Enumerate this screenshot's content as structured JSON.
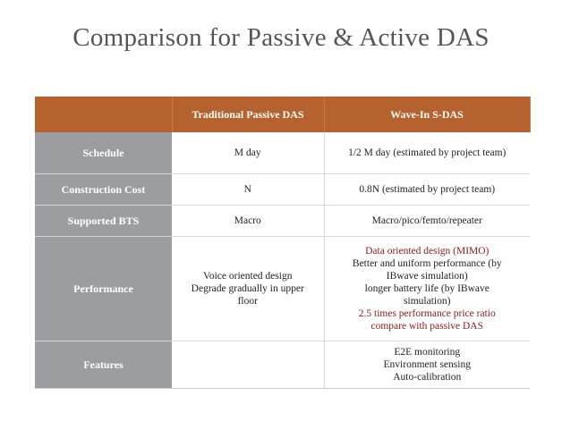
{
  "title": "Comparison for Passive & Active DAS",
  "table": {
    "header": {
      "corner": "",
      "col1": "Traditional Passive DAS",
      "col2": "Wave-In S-DAS"
    },
    "rows": [
      {
        "label": "Schedule",
        "passive": [
          "M day"
        ],
        "active": [
          {
            "text": "1/2 M day (estimated by project team)",
            "highlight": false
          }
        ]
      },
      {
        "label": "Construction Cost",
        "passive": [
          "N"
        ],
        "active": [
          {
            "text": "0.8N (estimated by project team)",
            "highlight": false
          }
        ]
      },
      {
        "label": "Supported BTS",
        "passive": [
          "Macro"
        ],
        "active": [
          {
            "text": "Macro/pico/femto/repeater",
            "highlight": false
          }
        ]
      },
      {
        "label": "Performance",
        "passive": [
          "Voice oriented design",
          "Degrade gradually in upper",
          "floor"
        ],
        "active": [
          {
            "text": "Data oriented design (MIMO)",
            "highlight": true
          },
          {
            "text": "Better and uniform performance (by",
            "highlight": false
          },
          {
            "text": "IBwave simulation)",
            "highlight": false
          },
          {
            "text": "longer battery life (by IBwave",
            "highlight": false
          },
          {
            "text": "simulation)",
            "highlight": false
          },
          {
            "text": "2.5 times performance price ratio",
            "highlight": true
          },
          {
            "text": "compare with passive DAS",
            "highlight": true
          }
        ]
      },
      {
        "label": "Features",
        "passive": [],
        "active": [
          {
            "text": "E2E monitoring",
            "highlight": false
          },
          {
            "text": "Environment sensing",
            "highlight": false
          },
          {
            "text": "Auto-calibration",
            "highlight": false
          }
        ]
      }
    ]
  },
  "colors": {
    "header_bg": "#b5622f",
    "label_bg": "#9b9da0",
    "highlight_text": "#8b1a1a"
  }
}
